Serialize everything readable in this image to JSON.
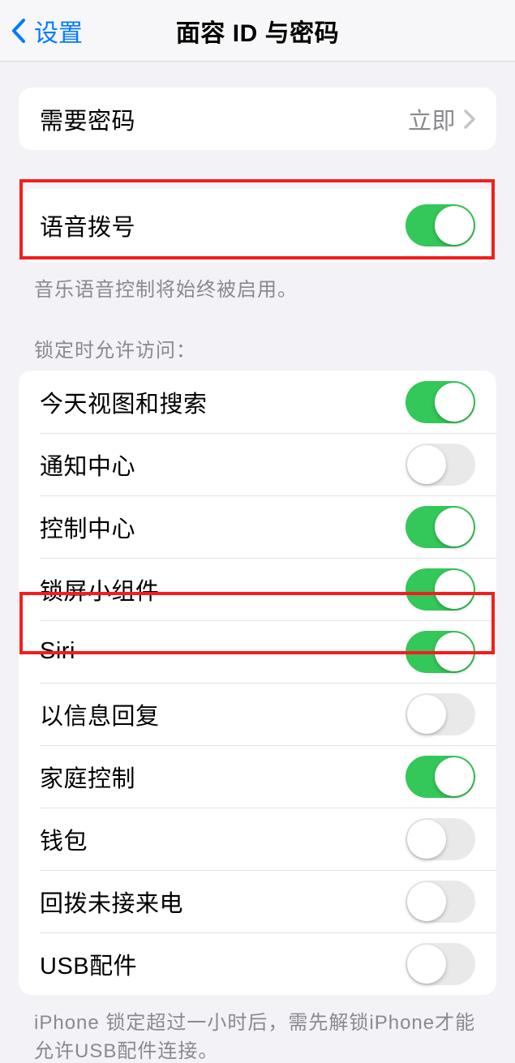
{
  "header": {
    "back_label": "设置",
    "title": "面容 ID 与密码"
  },
  "require_passcode": {
    "label": "需要密码",
    "value": "立即"
  },
  "voice_dial": {
    "label": "语音拨号",
    "on": true,
    "footer": "音乐语音控制将始终被启用。"
  },
  "lock_access": {
    "header": "锁定时允许访问：",
    "items": [
      {
        "label": "今天视图和搜索",
        "on": true
      },
      {
        "label": "通知中心",
        "on": false
      },
      {
        "label": "控制中心",
        "on": true
      },
      {
        "label": "锁屏小组件",
        "on": true
      },
      {
        "label": "Siri",
        "on": true
      },
      {
        "label": "以信息回复",
        "on": false
      },
      {
        "label": "家庭控制",
        "on": true
      },
      {
        "label": "钱包",
        "on": false
      },
      {
        "label": "回拨未接来电",
        "on": false
      },
      {
        "label": "USB配件",
        "on": false
      }
    ],
    "footer": "iPhone 锁定超过一小时后，需先解锁iPhone才能允许USB配件连接。"
  }
}
